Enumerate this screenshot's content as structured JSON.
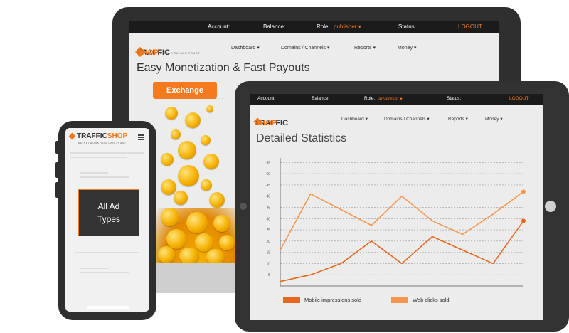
{
  "laptop": {
    "topbar": {
      "account": "Account:",
      "balance": "Balance:",
      "role_label": "Role:",
      "role_value": "publisher",
      "status": "Status:",
      "logout": "LOGOUT"
    },
    "logo": {
      "part1": "TRAFFIC",
      "part2": "SHOP",
      "tagline": "AD NETWORK YOU CAN TRUST"
    },
    "nav": [
      "Dashboard",
      "Domains / Channels",
      "Reports",
      "Money"
    ],
    "heading": "Easy Monetization & Fast Payouts",
    "exchange_label": "Exchange"
  },
  "tablet": {
    "topbar": {
      "account": "Account:",
      "balance": "Balance:",
      "role_label": "Role:",
      "role_value": "advertiser",
      "status": "Status:",
      "logout": "LOGOUT"
    },
    "logo": {
      "part1": "TRAFFIC",
      "part2": "SHOP"
    },
    "nav": [
      "Dashboard",
      "Domains / Channels",
      "Reports",
      "Money"
    ],
    "title": "Detailed Statistics"
  },
  "phone": {
    "logo": {
      "part1": "TRAFFIC",
      "part2": "SHOP",
      "tagline": "AD NETWORK YOU CAN TRUST"
    },
    "ad_line1": "All Ad",
    "ad_line2": "Types"
  },
  "colors": {
    "accent": "#f37a1f",
    "dark": "#1b1b1b",
    "series1": "#e8671c",
    "series2": "#f5964f"
  },
  "icons": {
    "menu": "hamburger-icon",
    "dropdown": "chevron-down-icon",
    "logo": "diamond-logo-icon"
  },
  "chart_data": {
    "type": "line",
    "yticks": [
      5,
      10,
      15,
      20,
      25,
      30,
      35,
      40,
      45,
      50,
      55
    ],
    "ylim": [
      0,
      57
    ],
    "x": [
      0,
      1,
      2,
      3,
      4,
      5,
      6,
      7,
      8
    ],
    "series": [
      {
        "name": "Mobile impressions sold",
        "values": [
          2,
          5,
          10,
          20,
          10,
          22,
          16,
          10,
          29
        ]
      },
      {
        "name": "Web clicks sold",
        "values": [
          16,
          41,
          34,
          27,
          40,
          29,
          23,
          32,
          42
        ]
      }
    ],
    "legend_position": "bottom"
  }
}
